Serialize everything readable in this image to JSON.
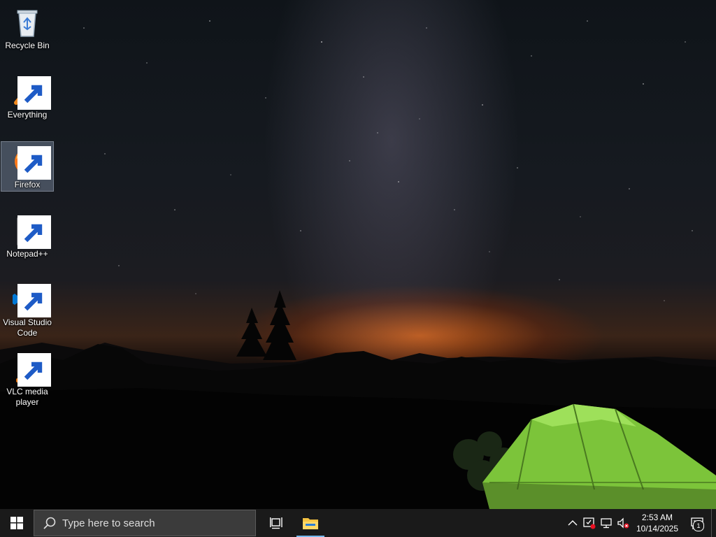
{
  "desktop": {
    "icons": [
      {
        "label": "Recycle Bin",
        "icon": "recycle-bin-icon",
        "shortcut": false,
        "selected": false
      },
      {
        "label": "Everything",
        "icon": "everything-search-icon",
        "shortcut": true,
        "selected": false
      },
      {
        "label": "Firefox",
        "icon": "firefox-icon",
        "shortcut": true,
        "selected": true
      },
      {
        "label": "Notepad++",
        "icon": "notepad-plus-plus-icon",
        "shortcut": true,
        "selected": false
      },
      {
        "label": "Visual Studio Code",
        "icon": "vscode-icon",
        "shortcut": true,
        "selected": false
      },
      {
        "label": "VLC media player",
        "icon": "vlc-icon",
        "shortcut": true,
        "selected": false
      }
    ]
  },
  "taskbar": {
    "search_placeholder": "Type here to search",
    "pinned": [
      {
        "name": "Task View",
        "icon": "task-view-icon",
        "active": false
      },
      {
        "name": "File Explorer",
        "icon": "file-explorer-icon",
        "active": true
      }
    ],
    "tray": {
      "icons": [
        "chevron-up-icon",
        "security-warning-icon",
        "network-disconnected-icon",
        "volume-muted-icon"
      ],
      "time": "2:53 AM",
      "date": "10/14/2025",
      "notification_count": "1"
    },
    "colors": {
      "bar": "#1a1a1a",
      "search_bg": "#3b3b3b",
      "accent": "#76b9ed"
    }
  }
}
